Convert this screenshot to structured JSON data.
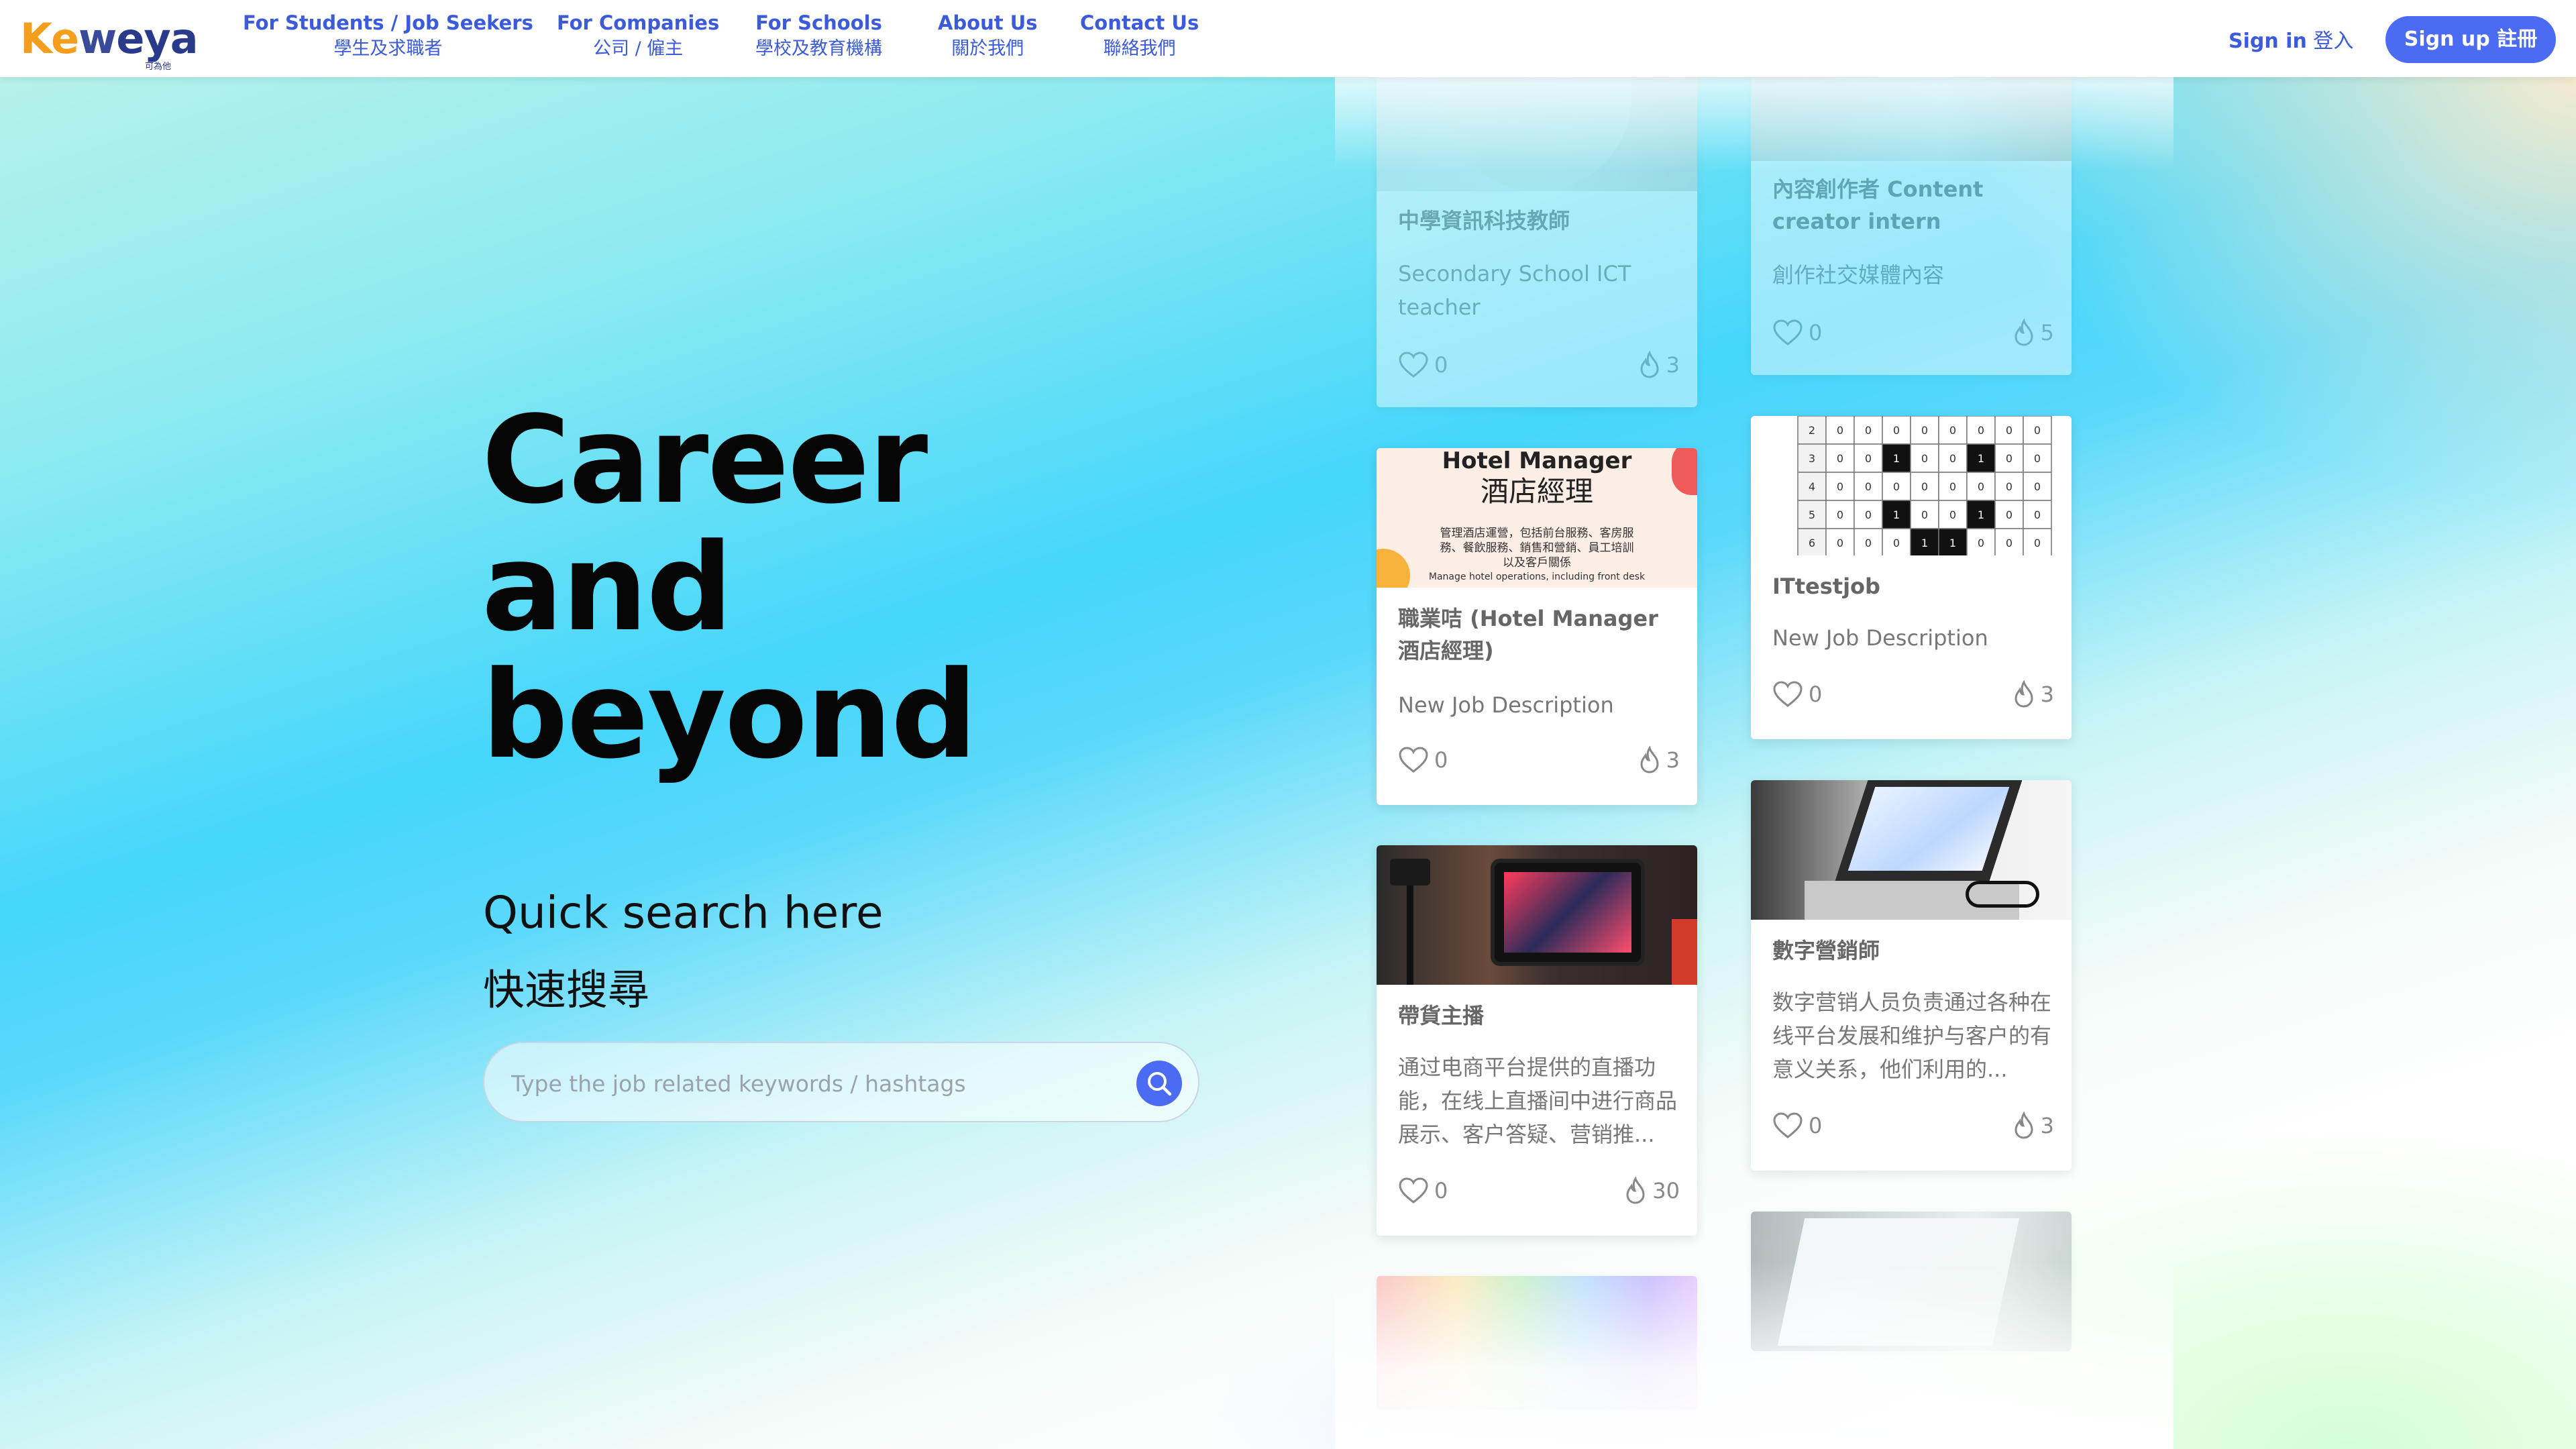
{
  "brand": {
    "name_k": "K",
    "name_e": "e",
    "name_w": "w",
    "name_rest": "eya",
    "sub": "可為他"
  },
  "nav": [
    {
      "en": "For Students / Job Seekers",
      "zh": "學生及求職者"
    },
    {
      "en": "For Companies",
      "zh": "公司 / 僱主"
    },
    {
      "en": "For Schools",
      "zh": "學校及教育機構"
    },
    {
      "en": "About Us",
      "zh": "關於我們"
    },
    {
      "en": "Contact Us",
      "zh": "聯絡我們"
    }
  ],
  "auth": {
    "signin_en": "Sign in",
    "signin_zh": "登入",
    "signup_en": "Sign up",
    "signup_zh": "註冊"
  },
  "hero": {
    "line1": "Career",
    "line2": "and",
    "line3": "beyond",
    "quick_en": "Quick search here",
    "quick_zh": "快速搜尋"
  },
  "search": {
    "placeholder": "Type the job related keywords / hashtags"
  },
  "hotel_img": {
    "t1": "Hotel Manager",
    "t2": "酒店經理",
    "d1": "管理酒店運營，包括前台服務、客房服",
    "d2": "務、餐飲服務、銷售和營銷、員工培訓",
    "d3": "以及客戶關係",
    "d4": "Manage hotel operations, including front desk"
  },
  "grid_img": {
    "rows": [
      [
        "2",
        "0",
        "0",
        "0",
        "0",
        "0",
        "0",
        "0",
        "0"
      ],
      [
        "3",
        "0",
        "0",
        "1",
        "0",
        "0",
        "1",
        "0",
        "0"
      ],
      [
        "4",
        "0",
        "0",
        "0",
        "0",
        "0",
        "0",
        "0",
        "0"
      ],
      [
        "5",
        "0",
        "0",
        "1",
        "0",
        "0",
        "1",
        "0",
        "0"
      ],
      [
        "6",
        "0",
        "0",
        "0",
        "1",
        "1",
        "0",
        "0",
        "0"
      ]
    ]
  },
  "cards": [
    {
      "title": "中學資訊科技教師",
      "desc": "Secondary School ICT teacher",
      "likes": "0",
      "hot": "3"
    },
    {
      "title": "內容創作者 Content creator intern",
      "desc": "創作社交媒體內容",
      "likes": "0",
      "hot": "5"
    },
    {
      "title": "職業咭 (Hotel Manager 酒店經理)",
      "desc": "New Job Description",
      "likes": "0",
      "hot": "3"
    },
    {
      "title": "ITtestjob",
      "desc": "New Job Description",
      "likes": "0",
      "hot": "3"
    },
    {
      "title": "帶貨主播",
      "desc": "通过电商平台提供的直播功能，在线上直播间中进行商品展示、客户答疑、营销推...",
      "likes": "0",
      "hot": "30"
    },
    {
      "title": "數字營銷師",
      "desc": "数字营销人员负责通过各种在线平台发展和维护与客户的有意义关系，他们利用的...",
      "likes": "0",
      "hot": "3"
    }
  ],
  "colors": {
    "accent": "#4b6bf2",
    "nav_text": "#3b5bdb",
    "logo_orange": "#f59d1c",
    "logo_navy": "#2a3a8a"
  }
}
